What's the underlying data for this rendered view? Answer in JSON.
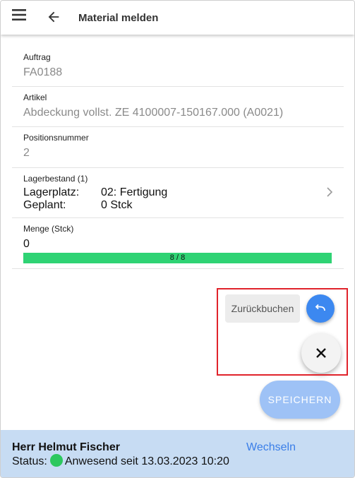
{
  "appbar": {
    "title": "Material melden",
    "menu_icon": "menu-icon",
    "back_icon": "arrow-back-icon"
  },
  "fields": {
    "auftrag": {
      "label": "Auftrag",
      "value": "FA0188"
    },
    "artikel": {
      "label": "Artikel",
      "value": "Abdeckung vollst. ZE 4100007-150167.000 (A0021)"
    },
    "position": {
      "label": "Positionsnummer",
      "value": "2"
    },
    "lager": {
      "label": "Lagerbestand (1)",
      "lagerplatz_key": "Lagerplatz:",
      "lagerplatz_val": "02: Fertigung",
      "geplant_key": "Geplant:",
      "geplant_val": "0 Stck"
    },
    "menge": {
      "label": "Menge (Stck)",
      "value": "0",
      "progress_text": "8 / 8",
      "progress_fraction": 1.0
    }
  },
  "speed_dial": {
    "label": "Zurückbuchen",
    "action_icon": "undo-icon",
    "close_icon": "close-icon"
  },
  "save_label": "SPEICHERN",
  "footer": {
    "name": "Herr Helmut Fischer",
    "status_prefix": "Status:",
    "status_text": "Anwesend seit 13.03.2023 10:20",
    "switch_label": "Wechseln"
  },
  "colors": {
    "accent": "#3c88f0",
    "progress": "#2fd374",
    "status_dot": "#2dc85e",
    "footer_bg": "#c7dcf3",
    "highlight": "#e0232b"
  }
}
